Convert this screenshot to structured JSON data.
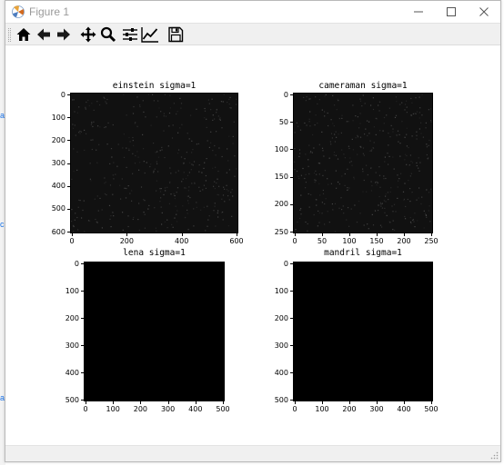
{
  "window": {
    "title": "Figure 1"
  },
  "background_marks": [
    "a",
    "c",
    "a"
  ],
  "toolbar": {
    "buttons": [
      {
        "name": "home-button",
        "icon": "home-icon",
        "tooltip": "Home"
      },
      {
        "name": "back-button",
        "icon": "arrow-left-icon",
        "tooltip": "Back"
      },
      {
        "name": "forward-button",
        "icon": "arrow-right-icon",
        "tooltip": "Forward"
      },
      {
        "name": "pan-button",
        "icon": "move-icon",
        "tooltip": "Pan"
      },
      {
        "name": "zoom-button",
        "icon": "magnifier-icon",
        "tooltip": "Zoom"
      },
      {
        "name": "subplots-button",
        "icon": "sliders-icon",
        "tooltip": "Subplots"
      },
      {
        "name": "customize-button",
        "icon": "line-chart-icon",
        "tooltip": "Customize"
      },
      {
        "name": "save-button",
        "icon": "floppy-disk-icon",
        "tooltip": "Save"
      }
    ]
  },
  "colors": {
    "title_inactive": "#9a9a9a",
    "image_dark": "#111111",
    "image_black": "#000000"
  },
  "figure": {
    "subplots": [
      {
        "id": "einstein",
        "title": "einstein sigma=1",
        "yticks": [
          "0",
          "100",
          "200",
          "300",
          "400",
          "500",
          "600"
        ],
        "xticks": [
          "0",
          "200",
          "400",
          "600"
        ],
        "appearance": "dark-noise"
      },
      {
        "id": "cameraman",
        "title": "cameraman sigma=1",
        "yticks": [
          "0",
          "50",
          "100",
          "150",
          "200",
          "250"
        ],
        "xticks": [
          "0",
          "50",
          "100",
          "150",
          "200",
          "250"
        ],
        "appearance": "dark-noise"
      },
      {
        "id": "lena",
        "title": "lena sigma=1",
        "yticks": [
          "0",
          "100",
          "200",
          "300",
          "400",
          "500"
        ],
        "xticks": [
          "0",
          "100",
          "200",
          "300",
          "400",
          "500"
        ],
        "appearance": "black"
      },
      {
        "id": "mandril",
        "title": "mandril sigma=1",
        "yticks": [
          "0",
          "100",
          "200",
          "300",
          "400",
          "500"
        ],
        "xticks": [
          "0",
          "100",
          "200",
          "300",
          "400",
          "500"
        ],
        "appearance": "black"
      }
    ]
  }
}
